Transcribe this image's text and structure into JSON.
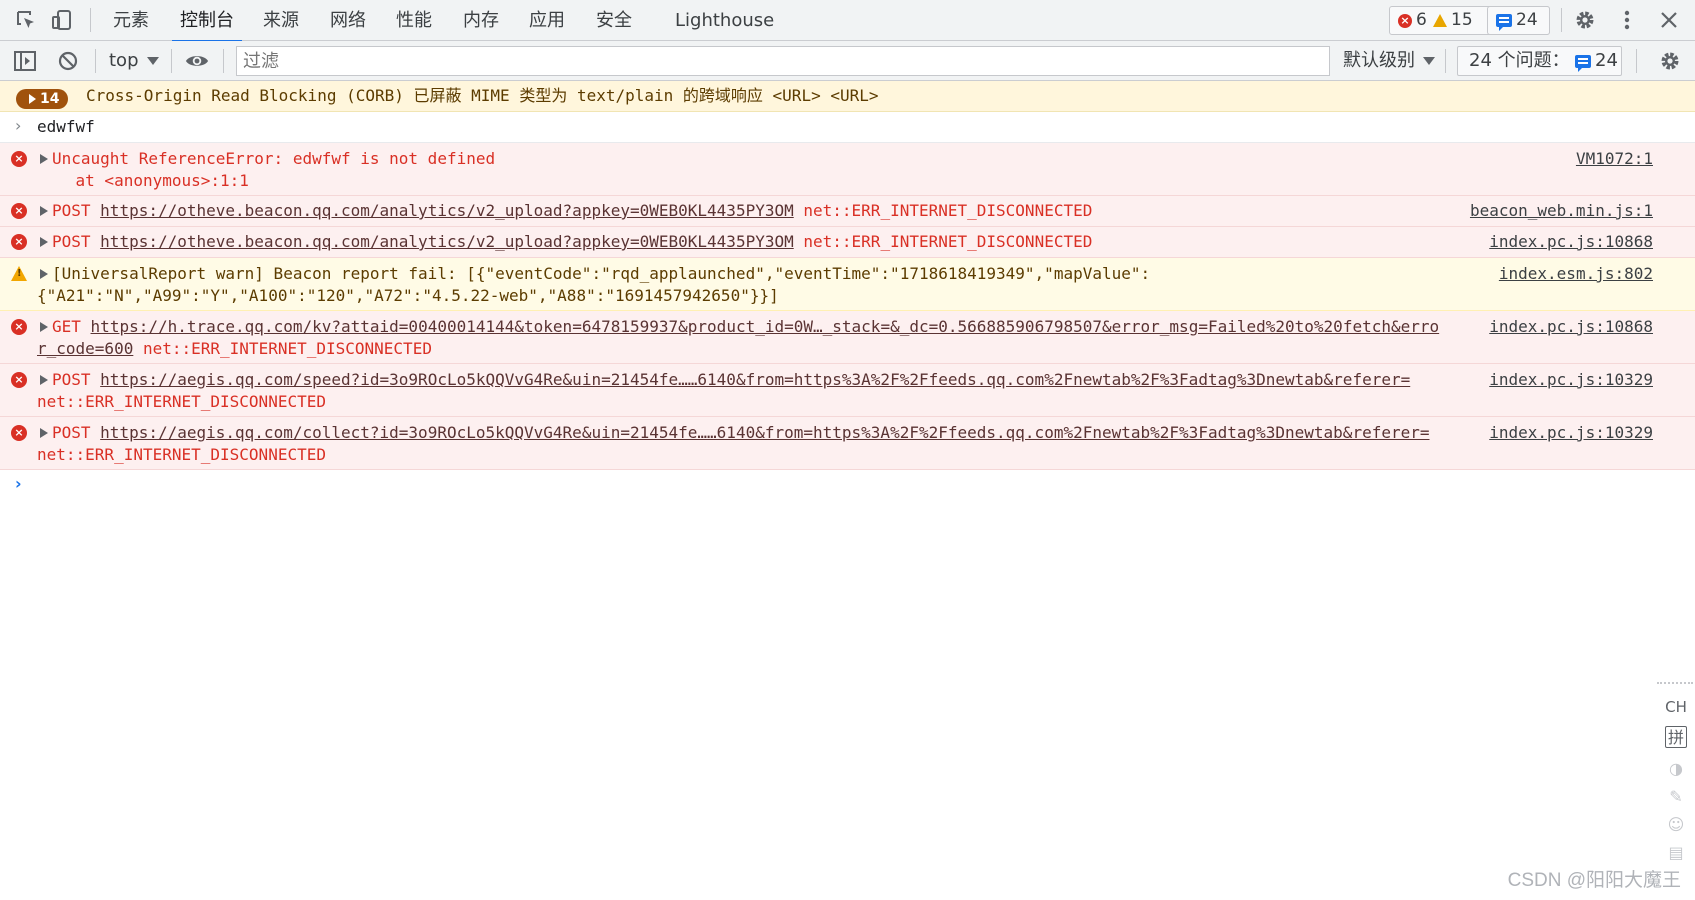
{
  "tabbar": {
    "tabs": [
      "元素",
      "控制台",
      "来源",
      "网络",
      "性能",
      "内存",
      "应用",
      "安全",
      "Lighthouse"
    ],
    "active_tab": "控制台",
    "error_count": "6",
    "warning_count": "15",
    "issue_count": "24"
  },
  "toolbar": {
    "context": "top",
    "filter_placeholder": "过滤",
    "level": "默认级别",
    "issues_label": "24 个问题：",
    "issues_count": "24"
  },
  "console": {
    "corb": {
      "count": "14",
      "text": "Cross-Origin Read Blocking (CORB) 已屏蔽 MIME 类型为 text/plain 的跨域响应 <URL> <URL>"
    },
    "input_echo": "edwfwf",
    "messages": [
      {
        "level": "error",
        "prefix": "Uncaught ReferenceError: edwfwf is not defined",
        "line2": "    at <anonymous>:1:1",
        "source": "VM1072:1"
      },
      {
        "level": "error",
        "method": "POST",
        "url": "https://otheve.beacon.qq.com/analytics/v2_upload?appkey=0WEB0KL4435PY3OM",
        "suffix": "net::ERR_INTERNET_DISCONNECTED",
        "source": "beacon_web.min.js:1"
      },
      {
        "level": "error",
        "method": "POST",
        "url": "https://otheve.beacon.qq.com/analytics/v2_upload?appkey=0WEB0KL4435PY3OM",
        "suffix": "net::ERR_INTERNET_DISCONNECTED",
        "source": "index.pc.js:10868"
      },
      {
        "level": "warning",
        "line1": "[UniversalReport warn] Beacon report fail: [{\"eventCode\":\"rqd_applaunched\",\"eventTime\":\"1718618419349\",\"mapValue\":",
        "line2": "{\"A21\":\"N\",\"A99\":\"Y\",\"A100\":\"120\",\"A72\":\"4.5.22-web\",\"A88\":\"1691457942650\"}}]",
        "source": "index.esm.js:802"
      },
      {
        "level": "error",
        "method": "GET",
        "url_line1": "https://h.trace.qq.com/kv?attaid=00400014144&token=6478159937&product_id=0W…_stack=&_dc=0.566885906798507&error_msg=Failed%20to%20fetch&erro",
        "url_line2": "r_code=600",
        "suffix": "net::ERR_INTERNET_DISCONNECTED",
        "source": "index.pc.js:10868"
      },
      {
        "level": "error",
        "method": "POST",
        "url": "https://aegis.qq.com/speed?id=3o9ROcLo5kQQVvG4Re&uin=21454fe……6140&from=https%3A%2F%2Ffeeds.qq.com%2Fnewtab%2F%3Fadtag%3Dnewtab&referer=",
        "suffix": "net::ERR_INTERNET_DISCONNECTED",
        "source": "index.pc.js:10329"
      },
      {
        "level": "error",
        "method": "POST",
        "url": "https://aegis.qq.com/collect?id=3o9ROcLo5kQQVvG4Re&uin=21454fe……6140&from=https%3A%2F%2Ffeeds.qq.com%2Fnewtab%2F%3Fadtag%3Dnewtab&referer=",
        "suffix": "net::ERR_INTERNET_DISCONNECTED",
        "source": "index.pc.js:10329"
      }
    ]
  },
  "ime": {
    "mode": "CH",
    "pinyin": "拼"
  },
  "watermark": "CSDN @阳阳大魔王",
  "colors": {
    "error": "#d93025",
    "warning": "#f2a600",
    "accent": "#1a73e8",
    "corb_badge": "#a0520d"
  },
  "icons": [
    "inspect-icon",
    "device-toggle-icon",
    "settings-icon",
    "more-icon",
    "close-icon",
    "sidebar-icon",
    "clear-icon",
    "eye-icon"
  ]
}
